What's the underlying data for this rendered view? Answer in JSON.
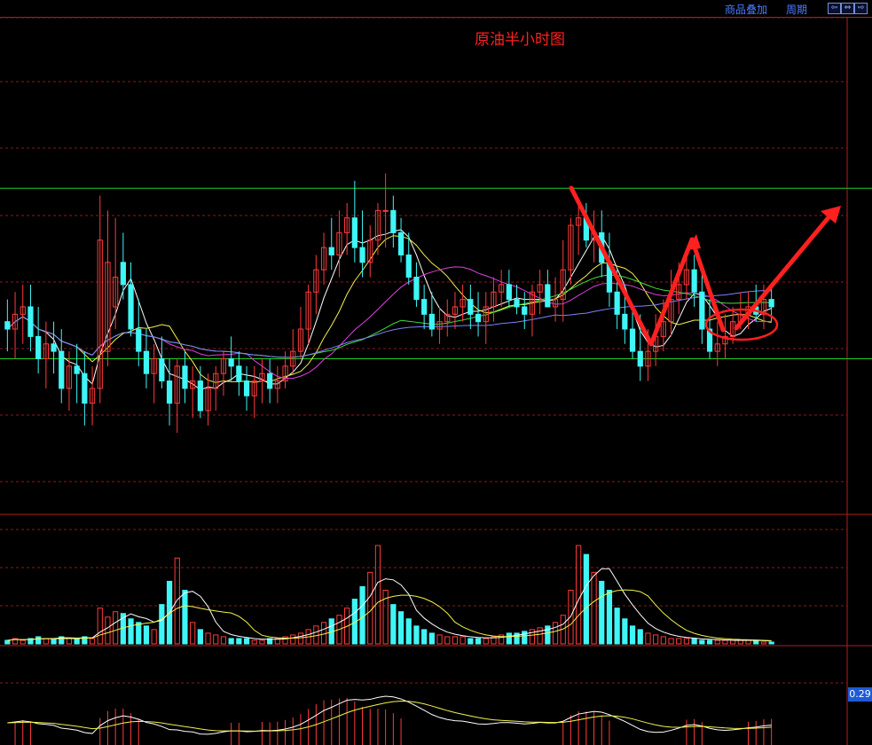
{
  "toolbar": {
    "overlay_label": "商品叠加",
    "period_label": "周期",
    "nav_left": "⇦",
    "nav_mid": "⇔",
    "nav_right": "⇨"
  },
  "indicator_value_label": "0.29",
  "colors": {
    "background": "#000000",
    "up": "#ff3b3b",
    "down": "#3ff6f6",
    "ma_white": "#ffffff",
    "ma_yellow": "#f2f24a",
    "ma_magenta": "#e040e0",
    "ma_green": "#40e040",
    "ma_purple": "#8080ff",
    "support_resistance": "#20d020",
    "grid": "#8a1a1a",
    "annotation": "#ff2020"
  },
  "chart_data": {
    "type": "candlestick",
    "title": "原油半小时图",
    "price": {
      "open": [
        52.4,
        52.3,
        52.5,
        52.6,
        52.2,
        51.9,
        52.1,
        52.0,
        51.5,
        51.8,
        51.7,
        51.3,
        51.5,
        52.0,
        52.6,
        53.2,
        52.9,
        52.3,
        52.0,
        51.7,
        51.9,
        51.6,
        51.3,
        51.8,
        51.5,
        51.6,
        51.2,
        51.5,
        51.7,
        51.9,
        51.8,
        51.6,
        51.4,
        51.6,
        51.7,
        51.5,
        51.6,
        51.8,
        52.0,
        52.3,
        52.8,
        53.1,
        53.4,
        53.3,
        53.6,
        53.8,
        53.4,
        53.2,
        53.5,
        53.9,
        53.9,
        53.6,
        53.3,
        53.0,
        52.7,
        52.5,
        52.3,
        52.4,
        52.5,
        52.6,
        52.7,
        52.5,
        52.4,
        52.6,
        52.8,
        52.9,
        52.7,
        52.6,
        52.5,
        52.8,
        52.9,
        52.6,
        52.7,
        53.1,
        53.7,
        53.8,
        53.5,
        53.6,
        53.2,
        52.8,
        52.5,
        52.3,
        52.0,
        51.8,
        52.0,
        52.2,
        52.4,
        52.7,
        52.9,
        53.1,
        52.8,
        52.3,
        52.0,
        52.1,
        52.2,
        52.4,
        52.5,
        52.6,
        52.5,
        52.7
      ],
      "high": [
        52.7,
        52.8,
        52.9,
        52.9,
        52.6,
        52.4,
        52.4,
        52.3,
        52.0,
        52.1,
        52.0,
        51.8,
        54.1,
        53.9,
        53.8,
        53.6,
        53.2,
        52.7,
        52.3,
        52.1,
        52.2,
        51.9,
        51.9,
        52.0,
        51.8,
        51.8,
        51.7,
        51.8,
        52.0,
        52.2,
        52.0,
        51.8,
        51.8,
        51.9,
        51.9,
        51.8,
        52.0,
        52.3,
        52.6,
        52.9,
        53.3,
        53.6,
        53.8,
        53.9,
        54.0,
        54.3,
        53.9,
        53.7,
        54.0,
        54.4,
        54.1,
        53.8,
        53.6,
        53.2,
        52.9,
        52.8,
        52.6,
        52.7,
        52.8,
        52.9,
        52.9,
        52.8,
        52.8,
        53.0,
        53.1,
        53.1,
        52.9,
        52.8,
        52.9,
        53.1,
        53.1,
        53.0,
        53.5,
        53.8,
        54.0,
        54.0,
        53.9,
        53.9,
        53.6,
        53.1,
        52.9,
        52.6,
        52.5,
        52.3,
        52.5,
        52.7,
        53.1,
        53.2,
        53.3,
        53.3,
        53.1,
        52.7,
        52.4,
        52.5,
        52.6,
        52.8,
        52.8,
        52.9,
        52.9,
        52.9
      ],
      "low": [
        52.0,
        51.9,
        52.1,
        52.0,
        51.7,
        51.5,
        51.7,
        51.3,
        51.2,
        51.3,
        51.0,
        51.0,
        51.3,
        51.8,
        52.3,
        52.7,
        52.2,
        51.8,
        51.5,
        51.3,
        51.5,
        51.0,
        50.9,
        51.3,
        51.1,
        51.1,
        51.0,
        51.2,
        51.4,
        51.6,
        51.4,
        51.2,
        51.1,
        51.3,
        51.3,
        51.3,
        51.5,
        51.7,
        51.9,
        52.1,
        52.5,
        52.9,
        53.1,
        53.0,
        53.3,
        53.2,
        53.0,
        53.0,
        53.3,
        53.4,
        53.4,
        53.2,
        52.9,
        52.6,
        52.3,
        52.2,
        52.1,
        52.2,
        52.3,
        52.4,
        52.3,
        52.2,
        52.1,
        52.4,
        52.6,
        52.6,
        52.5,
        52.3,
        52.2,
        52.5,
        52.6,
        52.4,
        52.4,
        52.9,
        53.3,
        53.4,
        53.2,
        53.0,
        52.6,
        52.3,
        52.1,
        51.9,
        51.6,
        51.6,
        51.8,
        52.0,
        52.2,
        52.5,
        52.7,
        52.6,
        52.1,
        51.9,
        51.8,
        51.9,
        52.1,
        52.3,
        52.3,
        52.4,
        52.3,
        52.4
      ],
      "close": [
        52.3,
        52.5,
        52.6,
        52.2,
        51.9,
        52.1,
        52.0,
        51.5,
        51.8,
        51.7,
        51.3,
        51.5,
        53.5,
        53.2,
        53.0,
        52.9,
        52.3,
        52.0,
        51.7,
        51.9,
        51.6,
        51.3,
        51.8,
        51.5,
        51.6,
        51.2,
        51.5,
        51.7,
        51.9,
        51.8,
        51.6,
        51.4,
        51.6,
        51.7,
        51.5,
        51.6,
        51.8,
        52.0,
        52.3,
        52.8,
        53.1,
        53.4,
        53.3,
        53.6,
        53.8,
        53.4,
        53.2,
        53.5,
        53.9,
        53.9,
        53.6,
        53.3,
        53.0,
        52.7,
        52.5,
        52.3,
        52.4,
        52.5,
        52.6,
        52.7,
        52.5,
        52.4,
        52.6,
        52.8,
        52.9,
        52.7,
        52.6,
        52.5,
        52.8,
        52.9,
        52.6,
        52.7,
        53.1,
        53.7,
        53.8,
        53.5,
        53.6,
        53.2,
        52.8,
        52.5,
        52.3,
        52.0,
        51.8,
        52.0,
        52.2,
        52.4,
        52.7,
        52.9,
        53.1,
        52.8,
        52.3,
        52.0,
        52.1,
        52.2,
        52.4,
        52.5,
        52.6,
        52.5,
        52.7,
        52.6
      ]
    },
    "volume": [
      2,
      3,
      2,
      3,
      4,
      3,
      3,
      4,
      3,
      3,
      4,
      3,
      20,
      15,
      18,
      17,
      14,
      12,
      10,
      8,
      22,
      35,
      48,
      30,
      12,
      8,
      6,
      5,
      4,
      3,
      3,
      3,
      2,
      2,
      3,
      3,
      4,
      5,
      6,
      8,
      10,
      12,
      14,
      16,
      20,
      25,
      32,
      40,
      55,
      30,
      22,
      18,
      14,
      10,
      8,
      6,
      5,
      4,
      4,
      4,
      3,
      3,
      3,
      4,
      5,
      6,
      6,
      7,
      8,
      9,
      10,
      12,
      16,
      30,
      55,
      50,
      40,
      35,
      30,
      20,
      14,
      10,
      8,
      6,
      5,
      4,
      3,
      3,
      3,
      3,
      2,
      2,
      2,
      2,
      2,
      2,
      2,
      2,
      1,
      1
    ],
    "support_line": 51.9,
    "resistance_line": 54.2,
    "y_range": [
      49.8,
      56.5
    ]
  }
}
